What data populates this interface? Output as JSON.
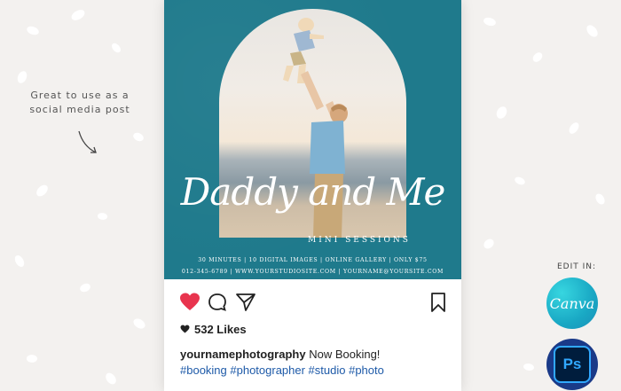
{
  "promo_note": {
    "line1": "Great to use as a",
    "line2": "social media post"
  },
  "post": {
    "title": "Daddy and Me",
    "subtitle": "MINI SESSIONS",
    "details_line1": "30 MINUTES | 10 DIGITAL IMAGES | ONLINE GALLERY | ONLY $75",
    "details_line2": "012-345-6789 | WWW.YOURSTUDIOSITE.COM | YOURNAME@YOURSITE.COM",
    "likes": "532 Likes",
    "username": "yournamephotography",
    "caption_text": "Now Booking!",
    "hashtags": "#booking #photographer #studio #photo"
  },
  "icons": {
    "like": "heart-icon",
    "comment": "comment-icon",
    "share": "send-icon",
    "save": "bookmark-icon"
  },
  "colors": {
    "post_background": "#1f7a8c",
    "like_red": "#e8344e",
    "hashtag_blue": "#1e5aa8",
    "canva_teal": "#19a8c4",
    "photoshop_navy": "#001d3d",
    "photoshop_blue": "#31a8ff"
  },
  "edit_in": {
    "label": "EDIT IN:",
    "canva_label": "Canva",
    "ps_label": "Ps"
  }
}
